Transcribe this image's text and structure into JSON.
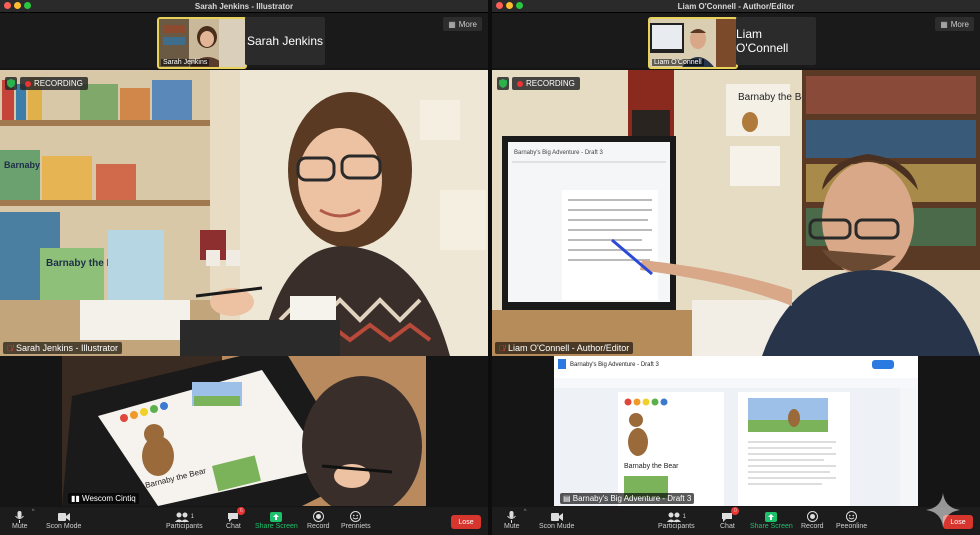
{
  "left_window": {
    "title": "Sarah Jenkins - Illustrator",
    "self_view_name": "Sarah Jenkins",
    "strip_name": "Sarah Jenkins",
    "more_label": "More",
    "recording_label": "RECORDING",
    "speaker_label": "Sarah Jenkins - Illustrator",
    "share_label": "Wescom Cintiq",
    "toolbar": {
      "mute": "Mute",
      "scan_mode": "Scon Mode",
      "participants": "Participants",
      "participants_count": "1",
      "chat": "Chat",
      "chat_badge": "6",
      "share": "Share Screen",
      "record": "Record",
      "reactions": "Prenniets",
      "leave": "Lose"
    }
  },
  "right_window": {
    "title": "Liam O'Connell - Author/Editor",
    "self_view_name": "Liam O'Connell",
    "strip_name": "Liam O'Connell",
    "more_label": "More",
    "recording_label": "RECORDING",
    "speaker_label": "Liam O'Connell - Author/Editor",
    "share_label": "Barnaby's Big Adventure - Draft 3",
    "toolbar": {
      "mute": "Mute",
      "scan_mode": "Scon Mude",
      "participants": "Participants",
      "participants_count": "1",
      "chat": "Chat",
      "chat_badge": "0",
      "share": "Share Screen",
      "record": "Record",
      "reactions": "Peeonline",
      "leave": "Lose"
    }
  },
  "poster_text": {
    "barnaby_poster": "Barnaby the Bear",
    "book_spine": "Barnaby the Bear",
    "tablet_caption": "Barnaby the Bear",
    "doc_caption": "Barnaby the Bear",
    "monitor_doc_title": "Barnaby's Big Adventure - Draft 3"
  },
  "colors": {
    "recording": "#e33333",
    "leave": "#d7362f",
    "share": "#1ec16b",
    "active_speaker": "#e8d25a"
  }
}
